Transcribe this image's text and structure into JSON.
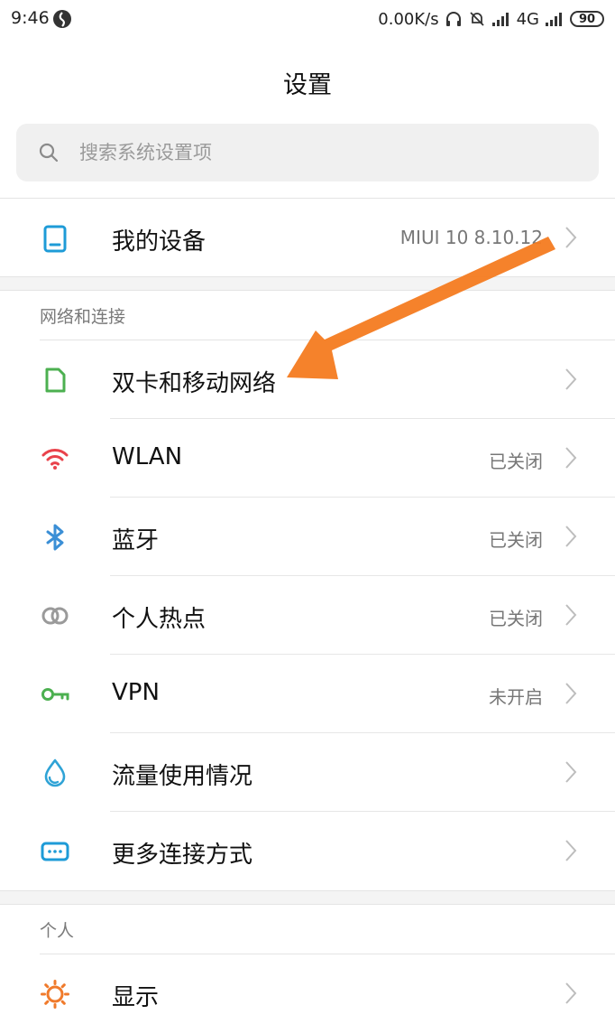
{
  "status_bar": {
    "time": "9:46",
    "speed": "0.00K/s",
    "network": "4G",
    "battery": "90"
  },
  "page": {
    "title": "设置"
  },
  "search": {
    "placeholder": "搜索系统设置项"
  },
  "my_device": {
    "label": "我的设备",
    "value": "MIUI 10 8.10.12",
    "icon": "tablet-icon",
    "icon_color": "#1e9bd7"
  },
  "network_section": {
    "header": "网络和连接",
    "items": [
      {
        "label": "双卡和移动网络",
        "value": "",
        "icon": "sim-card-icon",
        "icon_color": "#4cb050"
      },
      {
        "label": "WLAN",
        "value": "已关闭",
        "icon": "wifi-icon",
        "icon_color": "#e9424b"
      },
      {
        "label": "蓝牙",
        "value": "已关闭",
        "icon": "bluetooth-icon",
        "icon_color": "#3b8fd6"
      },
      {
        "label": "个人热点",
        "value": "已关闭",
        "icon": "hotspot-icon",
        "icon_color": "#9a9a9a"
      },
      {
        "label": "VPN",
        "value": "未开启",
        "icon": "vpn-key-icon",
        "icon_color": "#4cb050"
      },
      {
        "label": "流量使用情况",
        "value": "",
        "icon": "data-usage-icon",
        "icon_color": "#2fa3d6"
      },
      {
        "label": "更多连接方式",
        "value": "",
        "icon": "more-connections-icon",
        "icon_color": "#1e9bd7"
      }
    ]
  },
  "personal_section": {
    "header": "个人",
    "items": [
      {
        "label": "显示",
        "value": "",
        "icon": "display-icon",
        "icon_color": "#f07a2b"
      }
    ]
  },
  "annotation": {
    "arrow_color": "#f47b20"
  }
}
